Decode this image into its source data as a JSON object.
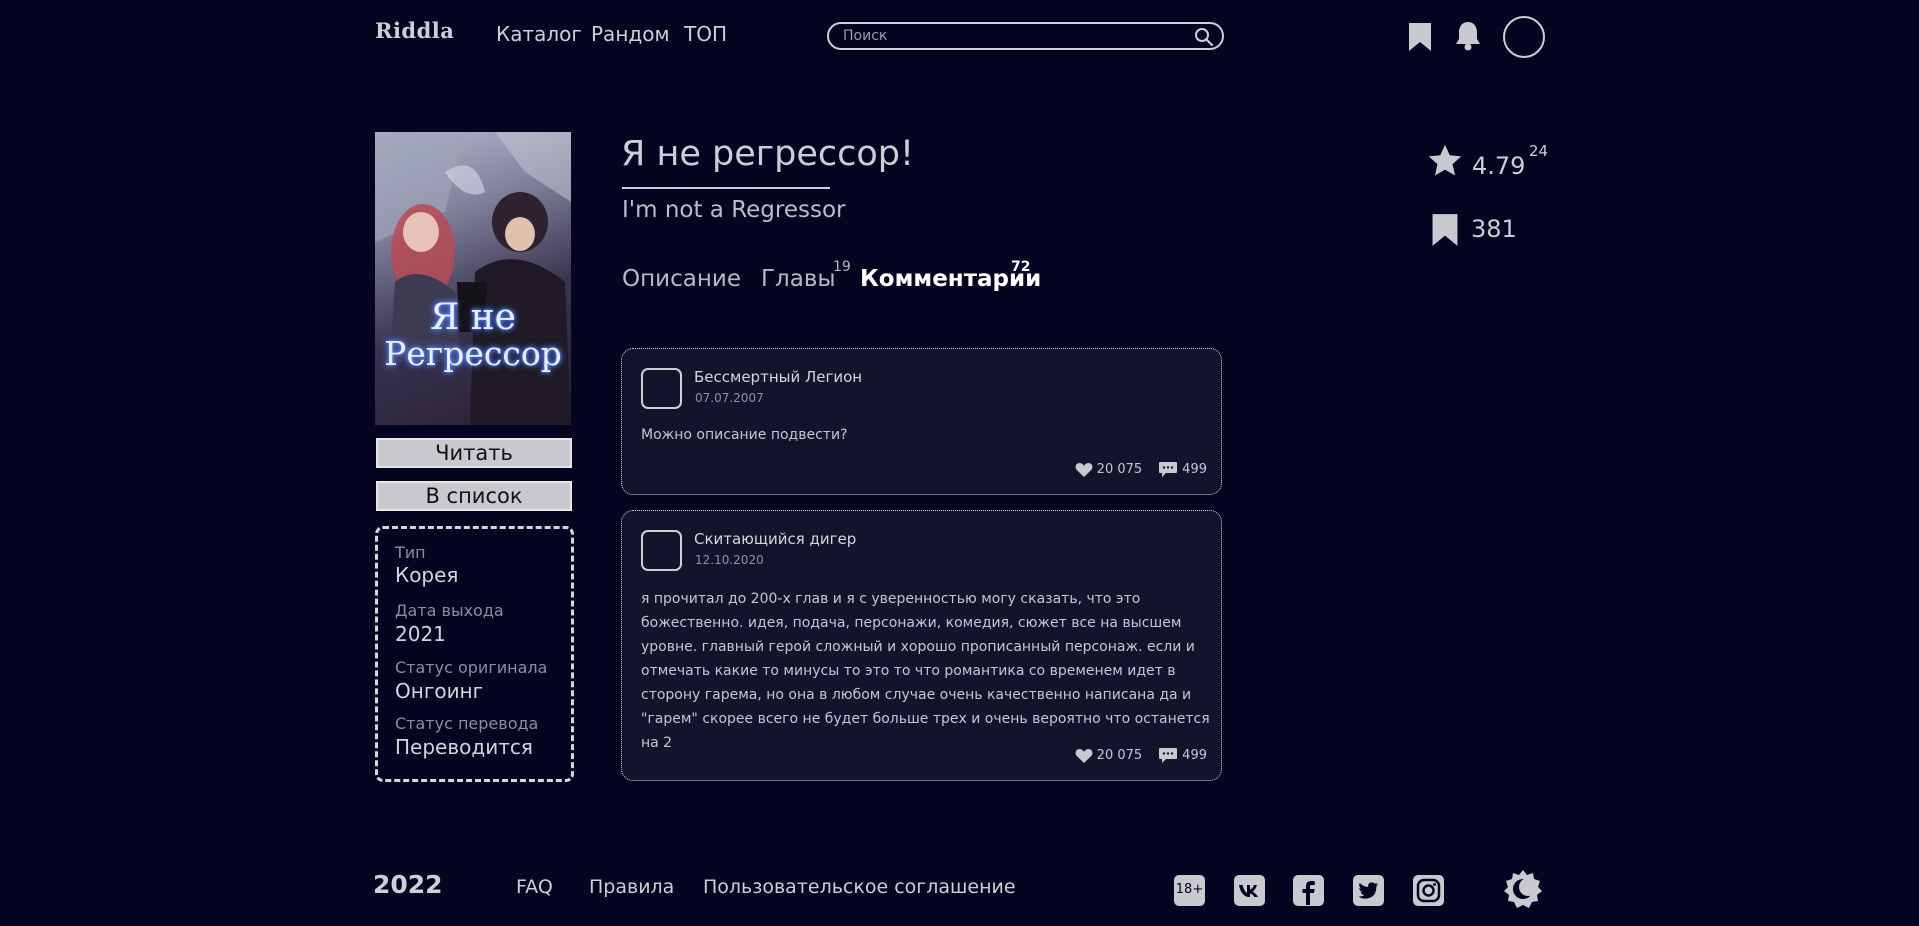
{
  "header": {
    "logo": "Riddla",
    "nav": [
      "Каталог",
      "Рандом",
      "ТОП"
    ],
    "search_placeholder": "Поиск",
    "icons": [
      "bookmark-icon",
      "bell-icon",
      "avatar"
    ]
  },
  "title": {
    "ru": "Я не регрессор!",
    "en": "I'm not a Regressor"
  },
  "cover": {
    "line1": "Я не",
    "line2": "Регрессор"
  },
  "actions": {
    "read": "Читать",
    "add_to_list": "В список"
  },
  "info": [
    {
      "label": "Тип",
      "value": "Корея"
    },
    {
      "label": "Дата выхода",
      "value": "2021"
    },
    {
      "label": "Статус оригинала",
      "value": "Онгоинг"
    },
    {
      "label": "Статус перевода",
      "value": "Переводится"
    }
  ],
  "tabs": [
    {
      "label": "Описание",
      "count": ""
    },
    {
      "label": "Главы",
      "count": "19"
    },
    {
      "label": "Комментарии",
      "count": "72",
      "active": true
    }
  ],
  "stats": {
    "rating": "4.79",
    "rating_votes": "24",
    "bookmarks": "381"
  },
  "comments": [
    {
      "author": "Бессмертный Легион",
      "date": "07.07.2007",
      "text": "Можно описание подвести?",
      "likes": "20 075",
      "replies": "499"
    },
    {
      "author": "Скитающийся дигер",
      "date": "12.10.2020",
      "text": "я прочитал до 200-х глав и я с уверенностью могу сказать, что это божественно. идея, подача, персонажи, комедия, сюжет все на высшем уровне. главный герой сложный и хорошо прописанный персонаж. если и отмечать какие то минусы то это то что романтика со временем идет в сторону гарема, но она в любом случае очень качественно написана да и \"гарем\" скорее всего не будет больше трех и очень вероятно что останется на 2",
      "likes": "20 075",
      "replies": "499"
    }
  ],
  "footer": {
    "year": "2022",
    "links": [
      "FAQ",
      "Правила",
      "Пользовательское соглашение"
    ],
    "age_badge": "18+",
    "socials": [
      "vk-icon",
      "facebook-icon",
      "twitter-icon",
      "instagram-icon",
      "theme-toggle-icon"
    ]
  },
  "colors": {
    "background": "#050421",
    "card": "#14132c",
    "text": "#d8d8e0",
    "muted": "#8d8d9b"
  }
}
